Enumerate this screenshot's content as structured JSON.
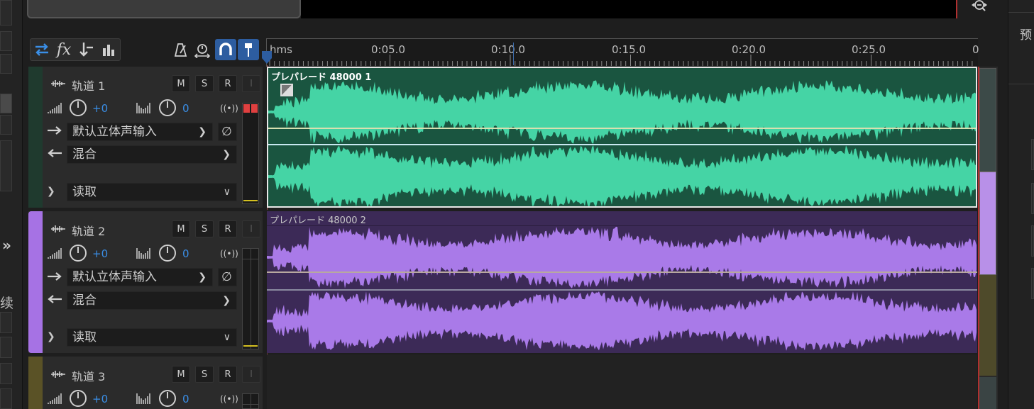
{
  "ruler": {
    "unit_label": "hms",
    "ticks": [
      "0:05.0",
      "0:10.0",
      "0:15.0",
      "0:20.0",
      "0:25.0",
      "0"
    ]
  },
  "toolbar": {
    "tools": [
      "switch-arrows-icon",
      "fx-icon",
      "input-output-icon",
      "bar-meter-icon",
      "metronome-icon",
      "loop-timer-icon",
      "magnet-icon",
      "pin-marker-icon"
    ],
    "fx_label": "fx"
  },
  "tracks": [
    {
      "name": "轨道 1",
      "color": "#1f3a2e",
      "m": "M",
      "s": "S",
      "r": "R",
      "i": "I",
      "volume": "+0",
      "pan": "0",
      "input": "默认立体声输入",
      "output": "混合",
      "automation": "读取",
      "clip_title": "プレパレード 48000 1",
      "clip_bg": "#1a5540",
      "wave_color": "#45d4a5"
    },
    {
      "name": "轨道 2",
      "color": "#a672e4",
      "m": "M",
      "s": "S",
      "r": "R",
      "i": "I",
      "volume": "+0",
      "pan": "0",
      "input": "默认立体声输入",
      "output": "混合",
      "automation": "读取",
      "clip_title": "プレパレード 48000 2",
      "clip_bg": "#3c2a57",
      "wave_color": "#a97ae8"
    },
    {
      "name": "轨道 3",
      "color": "#5a5226",
      "m": "M",
      "s": "S",
      "r": "R",
      "i": "I",
      "volume": "+0",
      "pan": "0"
    }
  ],
  "left_panel": {
    "collapse_glyph": "»",
    "partial_char": "续"
  },
  "right_panel": {
    "preset_label": "预"
  }
}
